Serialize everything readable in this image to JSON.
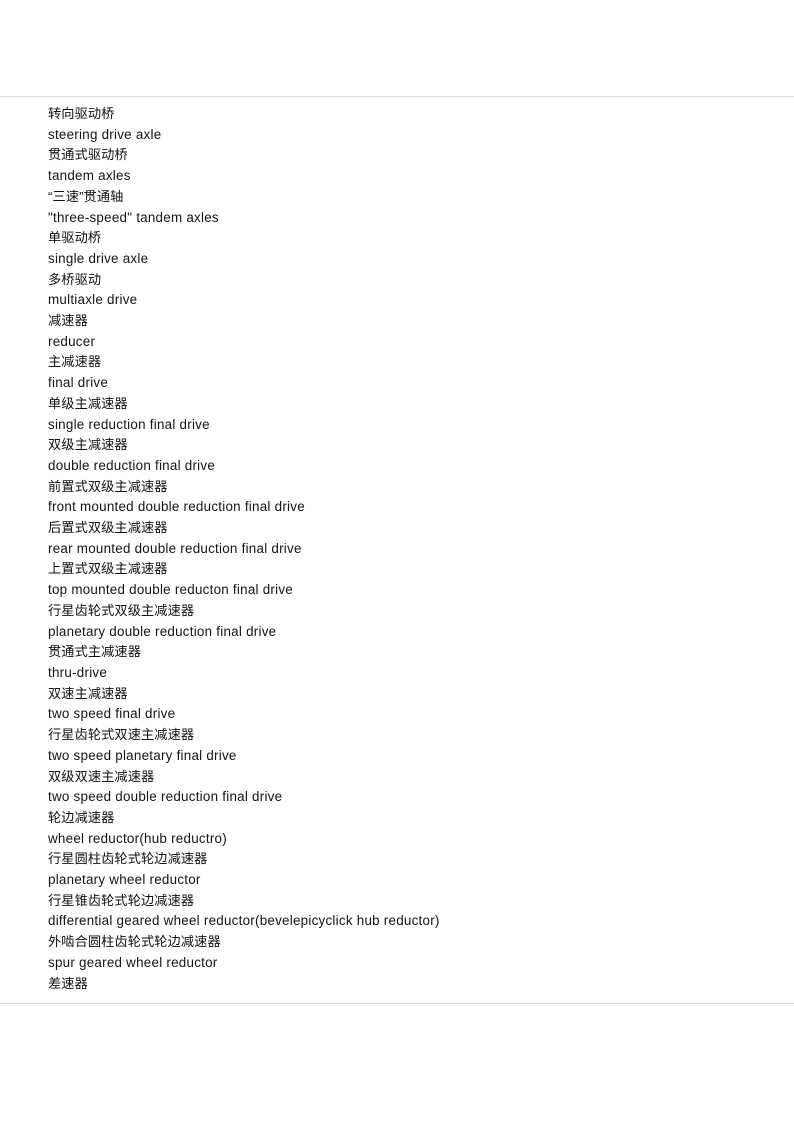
{
  "document": {
    "language_pair": "Chinese-English",
    "rules": {
      "top_label": "top-horizontal-rule",
      "bottom_label": "bottom-horizontal-rule",
      "color": "#d9d9d9"
    },
    "text_color": "#141414",
    "background_color": "#ffffff"
  },
  "glossary": {
    "entries": [
      {
        "zh": "转向驱动桥",
        "en": "steering drive axle"
      },
      {
        "zh": "贯通式驱动桥",
        "en": "tandem axles"
      },
      {
        "zh": "“三速”贯通轴",
        "en": "\"three-speed\" tandem axles"
      },
      {
        "zh": "单驱动桥",
        "en": "single drive axle"
      },
      {
        "zh": "多桥驱动",
        "en": "multiaxle drive"
      },
      {
        "zh": "减速器",
        "en": "reducer"
      },
      {
        "zh": "主减速器",
        "en": "final drive"
      },
      {
        "zh": "单级主减速器",
        "en": "single reduction final drive"
      },
      {
        "zh": "双级主减速器",
        "en": "double reduction final drive"
      },
      {
        "zh": "前置式双级主减速器",
        "en": "front mounted double reduction final drive"
      },
      {
        "zh": "后置式双级主减速器",
        "en": "rear mounted double reduction final drive"
      },
      {
        "zh": "上置式双级主减速器",
        "en": "top mounted double reducton final drive"
      },
      {
        "zh": "行星齿轮式双级主减速器",
        "en": "planetary double reduction final drive"
      },
      {
        "zh": "贯通式主减速器",
        "en": "thru-drive"
      },
      {
        "zh": "双速主减速器",
        "en": "two speed final drive"
      },
      {
        "zh": "行星齿轮式双速主减速器",
        "en": "two speed planetary final drive"
      },
      {
        "zh": "双级双速主减速器",
        "en": "two speed double reduction final drive"
      },
      {
        "zh": "轮边减速器",
        "en": "wheel reductor(hub reductro)"
      },
      {
        "zh": "行星圆柱齿轮式轮边减速器",
        "en": "planetary wheel reductor"
      },
      {
        "zh": "行星锥齿轮式轮边减速器",
        "en": "differential geared wheel reductor(bevelepicyclick hub reductor)"
      },
      {
        "zh": "外啮合圆柱齿轮式轮边减速器",
        "en": "spur geared wheel reductor"
      }
    ],
    "trailing_zh": "差速器"
  }
}
